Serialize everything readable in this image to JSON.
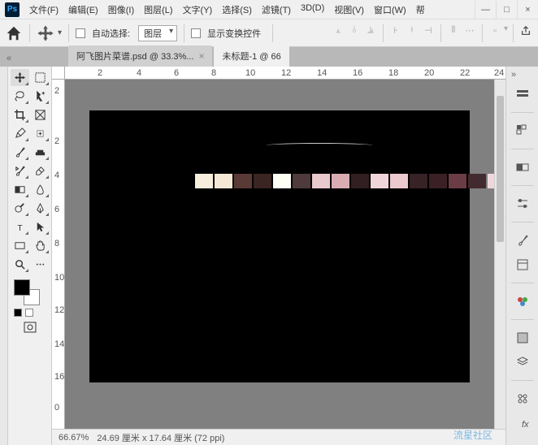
{
  "app": {
    "logo": "Ps"
  },
  "menu": {
    "items": [
      "文件(F)",
      "编辑(E)",
      "图像(I)",
      "图层(L)",
      "文字(Y)",
      "选择(S)",
      "滤镜(T)",
      "3D(D)",
      "视图(V)",
      "窗口(W)",
      "帮"
    ]
  },
  "window_controls": {
    "minimize": "—",
    "maximize": "□",
    "close": "×"
  },
  "options": {
    "auto_select_label": "自动选择:",
    "layer_select": "图层",
    "transform_label": "显示变换控件"
  },
  "tabs": [
    {
      "label": "阿飞图片菜谱.psd @ 33.3%...",
      "active": false
    },
    {
      "label": "未标题-1 @ 66",
      "active": true
    }
  ],
  "ruler_h": [
    "2",
    "4",
    "6",
    "8",
    "10",
    "12",
    "14",
    "16",
    "18",
    "20",
    "22",
    "24"
  ],
  "ruler_v": [
    "2",
    "2",
    "4",
    "6",
    "8",
    "10",
    "12",
    "14",
    "16",
    "0"
  ],
  "canvas_pixels": [
    "#f7eedd",
    "#f5e9d6",
    "#5a3a36",
    "#3a2523",
    "#fdfef4",
    "#4f3a3c",
    "#eac9cd",
    "#d8acb1",
    "#321f21",
    "#efd4d9",
    "#ecc9cd",
    "#372226",
    "#3b2125",
    "#6b3c44",
    "#422a30",
    "#f0d7dc",
    "#5c3a41"
  ],
  "status": {
    "zoom": "66.67%",
    "dims": "24.69 厘米 x 17.64 厘米 (72 ppi)"
  },
  "watermark": "流星社区",
  "tools": {
    "move": "move",
    "artboard": "artboard",
    "lasso": "lasso",
    "quick-select": "quick-select",
    "crop": "crop",
    "frame": "frame",
    "eyedropper": "eyedropper",
    "spot-heal": "spot-heal",
    "brush": "brush",
    "clone": "clone",
    "history-brush": "history-brush",
    "eraser": "eraser",
    "gradient": "gradient",
    "blur": "blur",
    "dodge": "dodge",
    "pen": "pen",
    "type": "type",
    "path-select": "path-select",
    "rectangle": "rectangle",
    "hand": "hand",
    "zoom": "zoom",
    "edit-toolbar": "edit-toolbar"
  }
}
